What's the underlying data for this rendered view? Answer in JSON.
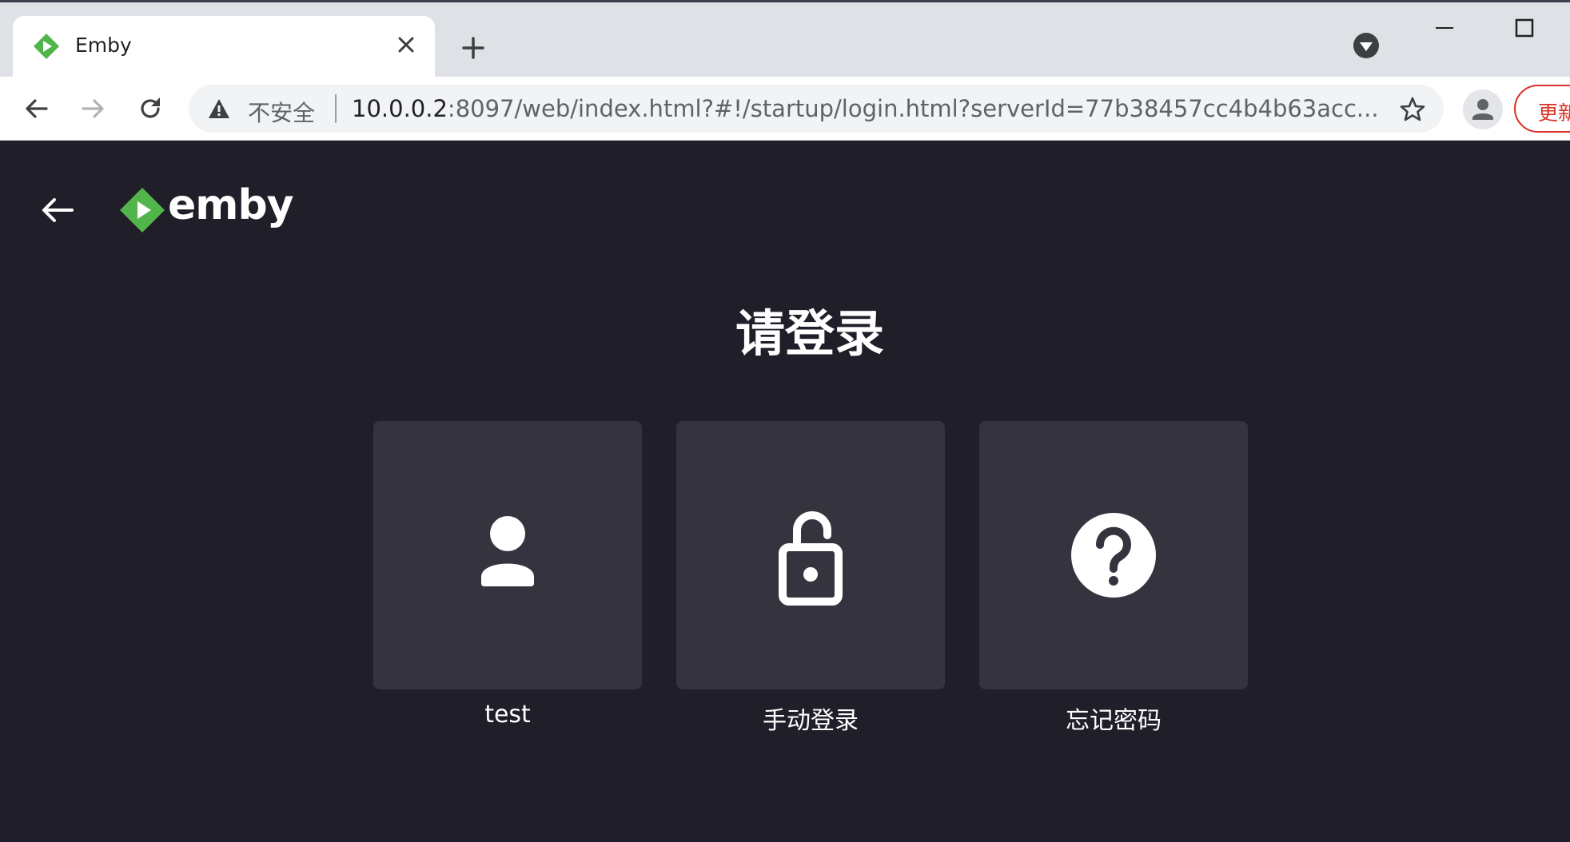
{
  "browser": {
    "tab_title": "Emby",
    "address": {
      "security_label": "不安全",
      "host": "10.0.0.2",
      "rest": ":8097/web/index.html?#!/startup/login.html?serverId=77b38457cc4b4b63acc..."
    },
    "update_label": "更新"
  },
  "page": {
    "logo_text": "emby",
    "heading": "请登录",
    "options": [
      {
        "label": "test",
        "icon": "user-icon"
      },
      {
        "label": "手动登录",
        "icon": "unlock-icon"
      },
      {
        "label": "忘记密码",
        "icon": "help-icon"
      }
    ]
  },
  "colors": {
    "page_bg": "#201e29",
    "card_bg": "#35333e",
    "emby_green": "#52b54b",
    "warning_red": "#d93025"
  }
}
